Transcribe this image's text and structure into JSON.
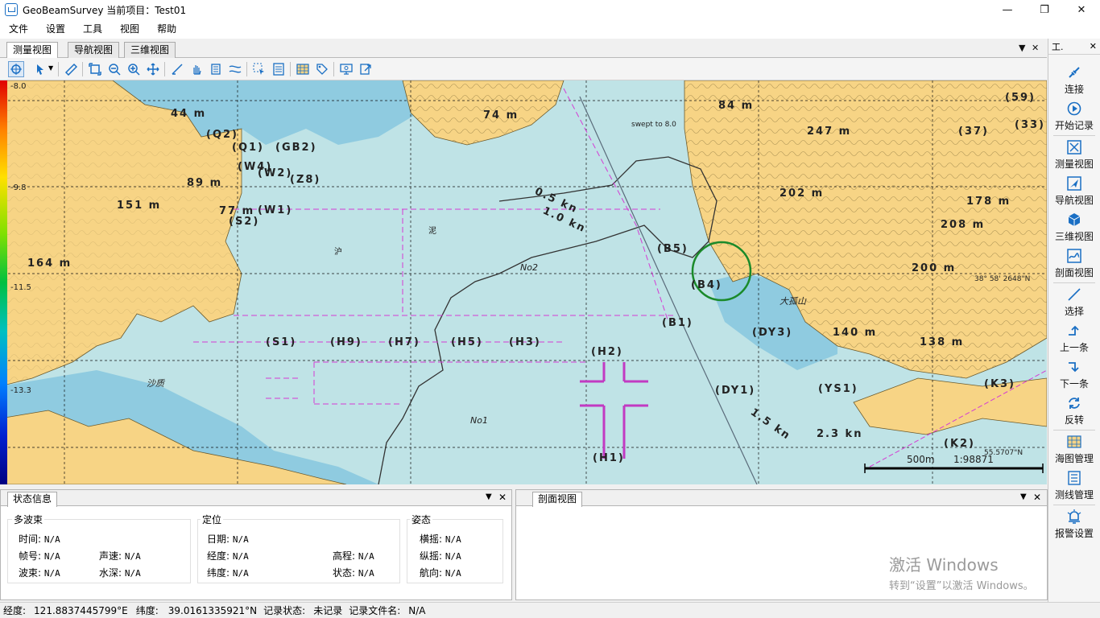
{
  "window": {
    "title": "GeoBeamSurvey  当前项目：Test01"
  },
  "menu": [
    "文件",
    "设置",
    "工具",
    "视图",
    "帮助"
  ],
  "tabs": [
    "测量视图",
    "导航视图",
    "三维视图"
  ],
  "map": {
    "depth_labels": [
      "-8.0",
      "-9.8",
      "-11.5",
      "-13.3"
    ],
    "heights": [
      "44 m",
      "89 m",
      "151 m",
      "164 m",
      "77 m",
      "74 m",
      "84 m",
      "247 m",
      "202 m",
      "178 m",
      "208 m",
      "200 m",
      "140 m",
      "138 m"
    ],
    "names": [
      "(Q2)",
      "(Q1)",
      "(GB2)",
      "(W4)",
      "(W2)",
      "(Z8)",
      "(W1)",
      "(S2)",
      "(B5)",
      "(B4)",
      "(B1)",
      "(S1)",
      "(H9)",
      "(H7)",
      "(H5)",
      "(H3)",
      "(H2)",
      "(H1)",
      "(DY3)",
      "(DY1)",
      "(YS1)",
      "(K3)",
      "(K2)",
      "(33)",
      "(37)",
      "(59)"
    ],
    "notes": [
      "沪",
      "泥",
      "No2",
      "No1",
      "大孤山",
      "沙质",
      "0.5 kn",
      "1.0 kn",
      "2.3 kn",
      "1.5 kn",
      "swept to  8.0"
    ],
    "scale_distance": "500m",
    "scale_ratio": "1:98871",
    "coord_right": "38° 58' 2648\"N",
    "coord_bottom_right": "55.5707\"N"
  },
  "right_panel": {
    "header": "工.",
    "items": [
      {
        "icon": "connect-icon",
        "label": "连接"
      },
      {
        "icon": "record-icon",
        "label": "开始记录"
      },
      {
        "icon": "measure-view-icon",
        "label": "测量视图"
      },
      {
        "icon": "nav-view-icon",
        "label": "导航视图"
      },
      {
        "icon": "cube-icon",
        "label": "三维视图"
      },
      {
        "icon": "profile-icon",
        "label": "剖面视图"
      },
      {
        "icon": "select-icon",
        "label": "选择"
      },
      {
        "icon": "up-icon",
        "label": "上一条"
      },
      {
        "icon": "down-icon",
        "label": "下一条"
      },
      {
        "icon": "reverse-icon",
        "label": "反转"
      },
      {
        "icon": "chart-manage-icon",
        "label": "海图管理"
      },
      {
        "icon": "line-manage-icon",
        "label": "测线管理"
      },
      {
        "icon": "alarm-icon",
        "label": "报警设置"
      }
    ]
  },
  "status_panel": {
    "tab": "状态信息",
    "multibeam": {
      "title": "多波束",
      "time_label": "时间:",
      "time": "N/A",
      "frame_label": "帧号:",
      "frame": "N/A",
      "sound_label": "声速:",
      "sound": "N/A",
      "beam_label": "波束:",
      "beam": "N/A",
      "depth_label": "水深:",
      "depth": "N/A"
    },
    "position": {
      "title": "定位",
      "date_label": "日期:",
      "date": "N/A",
      "lon_label": "经度:",
      "lon": "N/A",
      "lat_label": "纬度:",
      "lat": "N/A",
      "elev_label": "高程:",
      "elev": "N/A",
      "state_label": "状态:",
      "state": "N/A"
    },
    "attitude": {
      "title": "姿态",
      "roll_label": "横摇:",
      "roll": "N/A",
      "pitch_label": "纵摇:",
      "pitch": "N/A",
      "heading_label": "航向:",
      "heading": "N/A"
    }
  },
  "profile_panel": {
    "tab": "剖面视图"
  },
  "statusbar": {
    "lon_label": "经度:",
    "lon": "121.8837445799°E",
    "lat_label": "纬度:",
    "lat": "39.0161335921°N",
    "rec_label": "记录状态:",
    "rec": "未记录",
    "file_label": "记录文件名:",
    "file": "N/A"
  },
  "watermark": {
    "title": "激活 Windows",
    "sub": "转到“设置”以激活 Windows。"
  },
  "colors": {
    "land": "#f7d485",
    "water": "#bfe3e6",
    "shallow": "#8fcbe0",
    "contour": "#6b5a2c",
    "magenta": "#d43bd4"
  }
}
